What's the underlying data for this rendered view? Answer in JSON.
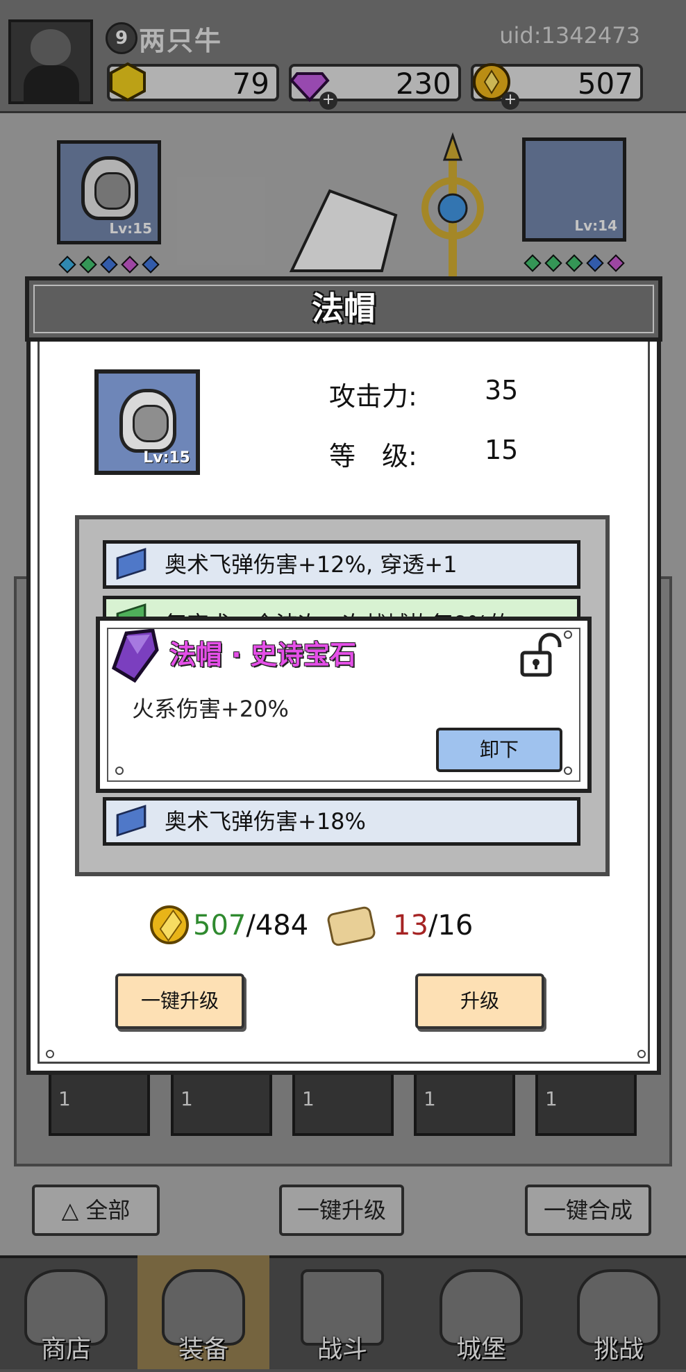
{
  "player": {
    "level": "9",
    "name": "两只牛",
    "uid": "uid:1342473"
  },
  "resources": [
    {
      "name": "energy",
      "icon": "hexagon-gem-icon",
      "value": "79"
    },
    {
      "name": "diamond",
      "icon": "diamond-icon",
      "value": "230"
    },
    {
      "name": "gold",
      "icon": "gold-coin-icon",
      "value": "507"
    }
  ],
  "equipment_slots": {
    "left_lv": "Lv:15",
    "right_lv": "Lv:14"
  },
  "panel": {
    "title": "法帽",
    "item_lv": "Lv:15",
    "stats": [
      {
        "label": "攻击力:",
        "value": "35"
      },
      {
        "label": "等　级:",
        "value": "15"
      }
    ]
  },
  "gems": [
    {
      "text": "奥术飞弹伤害+12%, 穿透+1"
    },
    {
      "text": "复宗术，全波次一次战城恢复9%的"
    },
    {
      "text": "奥术飞弹伤害+18%"
    }
  ],
  "popup": {
    "title": "法帽 · 史诗宝石",
    "desc": "火系伤害+20%",
    "unload_label": "卸下"
  },
  "cost": {
    "gold_have": "507",
    "gold_need": "/484",
    "scroll_have": "13",
    "scroll_need": "/16"
  },
  "buttons": {
    "upgrade_all": "一键升级",
    "upgrade": "升级"
  },
  "bag_counts": [
    "1",
    "1",
    "1",
    "1",
    "1"
  ],
  "bottom": {
    "all": "全部",
    "upgrade_all": "一键升级",
    "merge_all": "一键合成"
  },
  "tabs": [
    {
      "label": "商店"
    },
    {
      "label": "装备"
    },
    {
      "label": "战斗"
    },
    {
      "label": "城堡"
    },
    {
      "label": "挑战"
    }
  ],
  "colors": {
    "epic_gem": "#e54fe8",
    "gold_enough": "#2f8a2f",
    "scroll_short": "#a52323",
    "upgrade_button": "#fde0b4"
  }
}
